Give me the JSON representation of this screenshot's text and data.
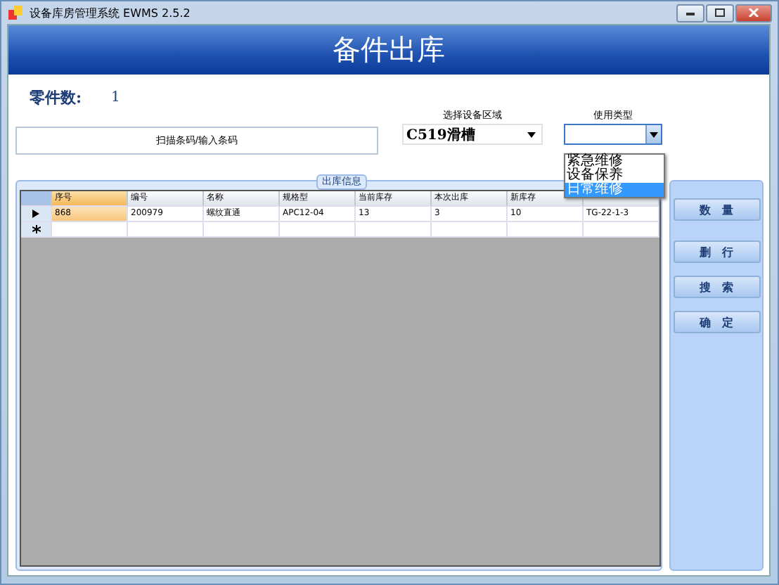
{
  "window": {
    "title": "设备库房管理系统 EWMS 2.5.2"
  },
  "banner": {
    "title": "备件出库"
  },
  "part_count": {
    "label": "零件数:",
    "value": "1"
  },
  "scan_field": {
    "placeholder": "扫描条码/输入条码"
  },
  "area_select": {
    "label": "选择设备区域",
    "value": "C519滑槽"
  },
  "usage_select": {
    "label": "使用类型",
    "expanded": true,
    "options": [
      {
        "label": "紧急维修",
        "selected": false
      },
      {
        "label": "设备保养",
        "selected": false
      },
      {
        "label": "日常维修",
        "selected": true
      }
    ]
  },
  "group": {
    "title": "出库信息"
  },
  "table": {
    "columns": [
      "序号",
      "编号",
      "名称",
      "规格型",
      "当前库存",
      "本次出库",
      "新库存"
    ],
    "rows": [
      {
        "current": true,
        "cells": [
          "868",
          "200979",
          "螺纹直通",
          "APC12-04",
          "13",
          "3",
          "10",
          "TG-22-1-3"
        ]
      }
    ],
    "new_row": true
  },
  "buttons": [
    "数　量",
    "删　行",
    "搜　索",
    "确　定"
  ]
}
